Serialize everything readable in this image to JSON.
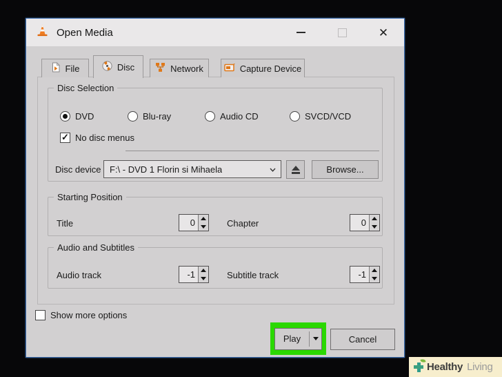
{
  "window": {
    "title": "Open Media"
  },
  "tabs": [
    {
      "label": "File",
      "icon": "file-icon",
      "selected": false
    },
    {
      "label": "Disc",
      "icon": "disc-icon",
      "selected": true
    },
    {
      "label": "Network",
      "icon": "network-icon",
      "selected": false
    },
    {
      "label": "Capture Device",
      "icon": "capture-device-icon",
      "selected": false
    }
  ],
  "disc_selection": {
    "group_label": "Disc Selection",
    "radios": [
      {
        "label": "DVD",
        "selected": true
      },
      {
        "label": "Blu-ray",
        "selected": false
      },
      {
        "label": "Audio CD",
        "selected": false
      },
      {
        "label": "SVCD/VCD",
        "selected": false
      }
    ],
    "no_disc_menus": {
      "label": "No disc menus",
      "checked": true
    },
    "disc_device": {
      "label": "Disc device",
      "value": "F:\\ - DVD 1 Florin si Mihaela",
      "browse_label": "Browse..."
    }
  },
  "starting_position": {
    "group_label": "Starting Position",
    "title": {
      "label": "Title",
      "value": "0"
    },
    "chapter": {
      "label": "Chapter",
      "value": "0"
    }
  },
  "audio_subtitles": {
    "group_label": "Audio and Subtitles",
    "audio_track": {
      "label": "Audio track",
      "value": "-1"
    },
    "subtitle_track": {
      "label": "Subtitle track",
      "value": "-1"
    }
  },
  "footer": {
    "show_more_options": {
      "label": "Show more options",
      "checked": false
    },
    "play_label": "Play",
    "cancel_label": "Cancel"
  },
  "watermark": {
    "bold": "Healthy",
    "light": "Living"
  },
  "icons": [
    "vlc-cone-icon",
    "file-icon",
    "disc-icon",
    "network-icon",
    "capture-device-icon",
    "minimize-icon",
    "maximize-icon",
    "close-icon",
    "dropdown-chevron-icon",
    "eject-icon",
    "spinner-up-icon",
    "spinner-down-icon",
    "play-dropdown-arrow-icon",
    "healthy-living-plus-icon"
  ],
  "colors": {
    "dialog_border": "#3a6cb0",
    "titlebar_bg": "#eae8e9",
    "dialog_bg": "#d2d0d1",
    "accent_orange": "#e07818",
    "highlight_green": "#2bd801",
    "watermark_bg": "#f7eecd",
    "watermark_teal": "#2f9c8c",
    "watermark_green": "#7cb93e",
    "background": "#070709"
  }
}
